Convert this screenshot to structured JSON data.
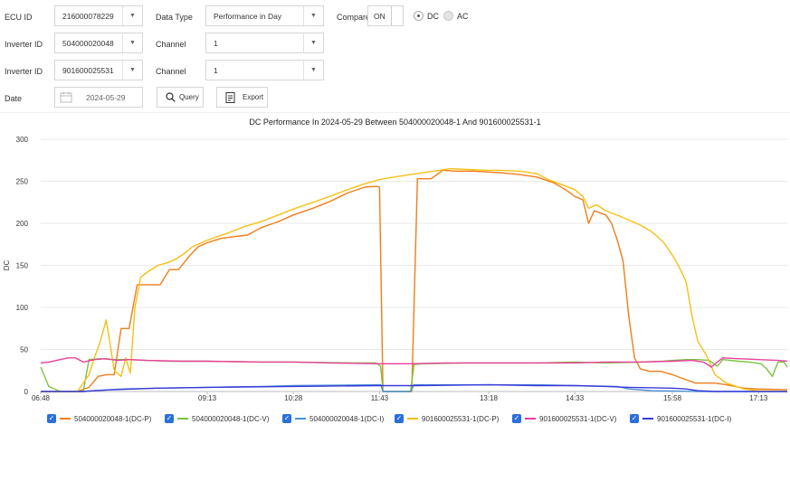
{
  "controls": {
    "ecu_label": "ECU ID",
    "ecu_value": "216000078229",
    "datatype_label": "Data Type",
    "datatype_value": "Performance in Day",
    "compare_label": "Compare",
    "compare_value": "ON",
    "radio_dc": "DC",
    "radio_ac": "AC",
    "inverter1_label": "Inverter ID",
    "inverter1_value": "504000020048",
    "channel1_label": "Channel",
    "channel1_value": "1",
    "inverter2_label": "Inverter ID",
    "inverter2_value": "901600025531",
    "channel2_label": "Channel",
    "channel2_value": "1",
    "date_label": "Date",
    "date_value": "2024-05-29",
    "query_label": "Query",
    "export_label": "Export"
  },
  "colors": {
    "s1_p": "#f07d1a",
    "s1_v": "#7cc242",
    "s1_i": "#4a90d9",
    "s2_p": "#f5c016",
    "s2_v": "#e8409b",
    "s2_i": "#3b3bd8",
    "checkbox": "#2a6fdb"
  },
  "chart_data": {
    "type": "line",
    "title": "DC Performance In 2024-05-29 Between 504000020048-1 And 901600025531-1",
    "ylabel": "DC",
    "xlabel": "",
    "ylim": [
      0,
      300
    ],
    "yticks": [
      0,
      50,
      100,
      150,
      200,
      250,
      300
    ],
    "xlim": [
      "06:48",
      "17:38"
    ],
    "xticks": [
      "06:48",
      "09:13",
      "10:28",
      "11:43",
      "13:18",
      "14:33",
      "15:58",
      "17:13"
    ],
    "grid": "horizontal",
    "legend_position": "bottom",
    "series": [
      {
        "name": "504000020048-1(DC-P)",
        "color_key": "s1_p",
        "points": [
          [
            "06:48",
            0
          ],
          [
            "07:20",
            0
          ],
          [
            "07:30",
            5
          ],
          [
            "07:38",
            18
          ],
          [
            "07:45",
            20
          ],
          [
            "07:52",
            20
          ],
          [
            "07:58",
            75
          ],
          [
            "08:05",
            75
          ],
          [
            "08:12",
            127
          ],
          [
            "08:20",
            127
          ],
          [
            "08:32",
            127
          ],
          [
            "08:40",
            145
          ],
          [
            "08:48",
            145
          ],
          [
            "08:58",
            162
          ],
          [
            "09:05",
            172
          ],
          [
            "09:13",
            177
          ],
          [
            "09:25",
            182
          ],
          [
            "09:35",
            184
          ],
          [
            "09:48",
            186
          ],
          [
            "10:00",
            195
          ],
          [
            "10:15",
            202
          ],
          [
            "10:28",
            210
          ],
          [
            "10:45",
            218
          ],
          [
            "11:00",
            226
          ],
          [
            "11:15",
            236
          ],
          [
            "11:30",
            243
          ],
          [
            "11:40",
            244
          ],
          [
            "11:43",
            243
          ],
          [
            "11:46",
            0
          ],
          [
            "12:11",
            0
          ],
          [
            "12:16",
            253
          ],
          [
            "12:28",
            253
          ],
          [
            "12:38",
            263
          ],
          [
            "12:50",
            262
          ],
          [
            "13:05",
            262
          ],
          [
            "13:18",
            261
          ],
          [
            "13:30",
            260
          ],
          [
            "13:45",
            258
          ],
          [
            "14:00",
            255
          ],
          [
            "14:15",
            248
          ],
          [
            "14:25",
            240
          ],
          [
            "14:33",
            232
          ],
          [
            "14:40",
            228
          ],
          [
            "14:45",
            200
          ],
          [
            "14:50",
            215
          ],
          [
            "15:00",
            210
          ],
          [
            "15:05",
            200
          ],
          [
            "15:10",
            180
          ],
          [
            "15:15",
            155
          ],
          [
            "15:20",
            90
          ],
          [
            "15:25",
            40
          ],
          [
            "15:30",
            27
          ],
          [
            "15:38",
            24
          ],
          [
            "15:48",
            24
          ],
          [
            "15:58",
            20
          ],
          [
            "16:08",
            15
          ],
          [
            "16:18",
            10
          ],
          [
            "16:35",
            10
          ],
          [
            "16:45",
            8
          ],
          [
            "17:00",
            4
          ],
          [
            "17:13",
            3
          ],
          [
            "17:38",
            2
          ]
        ]
      },
      {
        "name": "504000020048-1(DC-V)",
        "color_key": "s1_v",
        "points": [
          [
            "06:48",
            29
          ],
          [
            "06:55",
            6
          ],
          [
            "07:05",
            0
          ],
          [
            "07:25",
            0
          ],
          [
            "07:30",
            38
          ],
          [
            "07:40",
            39
          ],
          [
            "07:50",
            38
          ],
          [
            "08:05",
            38
          ],
          [
            "08:20",
            37
          ],
          [
            "08:40",
            36
          ],
          [
            "09:13",
            36
          ],
          [
            "10:00",
            35
          ],
          [
            "10:28",
            35
          ],
          [
            "11:20",
            34
          ],
          [
            "11:40",
            34
          ],
          [
            "11:44",
            30
          ],
          [
            "11:46",
            0
          ],
          [
            "12:10",
            0
          ],
          [
            "12:13",
            32
          ],
          [
            "12:20",
            33
          ],
          [
            "13:00",
            34
          ],
          [
            "13:18",
            34
          ],
          [
            "14:00",
            34
          ],
          [
            "14:33",
            35
          ],
          [
            "15:00",
            34
          ],
          [
            "15:30",
            35
          ],
          [
            "15:50",
            36
          ],
          [
            "15:58",
            37
          ],
          [
            "16:10",
            38
          ],
          [
            "16:20",
            38
          ],
          [
            "16:30",
            37
          ],
          [
            "16:37",
            30
          ],
          [
            "16:42",
            38
          ],
          [
            "16:55",
            36
          ],
          [
            "17:05",
            35
          ],
          [
            "17:15",
            33
          ],
          [
            "17:20",
            27
          ],
          [
            "17:25",
            18
          ],
          [
            "17:30",
            35
          ],
          [
            "17:35",
            35
          ],
          [
            "17:38",
            29
          ]
        ]
      },
      {
        "name": "504000020048-1(DC-I)",
        "color_key": "s1_i",
        "points": [
          [
            "06:48",
            0
          ],
          [
            "07:25",
            0
          ],
          [
            "07:35",
            1
          ],
          [
            "08:00",
            3
          ],
          [
            "08:30",
            4
          ],
          [
            "09:13",
            5
          ],
          [
            "10:00",
            6
          ],
          [
            "10:28",
            7
          ],
          [
            "11:40",
            8
          ],
          [
            "11:44",
            8
          ],
          [
            "11:46",
            0
          ],
          [
            "12:10",
            0
          ],
          [
            "12:13",
            8
          ],
          [
            "13:18",
            8
          ],
          [
            "14:00",
            8
          ],
          [
            "14:33",
            7
          ],
          [
            "15:10",
            6
          ],
          [
            "15:20",
            3
          ],
          [
            "15:40",
            1
          ],
          [
            "16:20",
            0
          ],
          [
            "17:38",
            0
          ]
        ]
      },
      {
        "name": "901600025531-1(DC-P)",
        "color_key": "s2_p",
        "points": [
          [
            "06:48",
            0
          ],
          [
            "07:20",
            0
          ],
          [
            "07:30",
            20
          ],
          [
            "07:36",
            45
          ],
          [
            "07:40",
            60
          ],
          [
            "07:45",
            85
          ],
          [
            "07:48",
            60
          ],
          [
            "07:52",
            25
          ],
          [
            "07:58",
            18
          ],
          [
            "08:02",
            40
          ],
          [
            "08:06",
            22
          ],
          [
            "08:10",
            100
          ],
          [
            "08:15",
            136
          ],
          [
            "08:22",
            143
          ],
          [
            "08:30",
            150
          ],
          [
            "08:38",
            153
          ],
          [
            "08:45",
            157
          ],
          [
            "08:52",
            163
          ],
          [
            "09:00",
            172
          ],
          [
            "09:13",
            180
          ],
          [
            "09:30",
            188
          ],
          [
            "09:45",
            196
          ],
          [
            "10:00",
            202
          ],
          [
            "10:15",
            210
          ],
          [
            "10:28",
            217
          ],
          [
            "10:45",
            225
          ],
          [
            "11:00",
            232
          ],
          [
            "11:15",
            240
          ],
          [
            "11:30",
            247
          ],
          [
            "11:43",
            252
          ],
          [
            "12:00",
            256
          ],
          [
            "12:15",
            259
          ],
          [
            "12:30",
            262
          ],
          [
            "12:45",
            265
          ],
          [
            "13:00",
            264
          ],
          [
            "13:18",
            263
          ],
          [
            "13:30",
            263
          ],
          [
            "13:45",
            262
          ],
          [
            "14:00",
            259
          ],
          [
            "14:10",
            252
          ],
          [
            "14:20",
            247
          ],
          [
            "14:33",
            240
          ],
          [
            "14:40",
            232
          ],
          [
            "14:45",
            218
          ],
          [
            "14:52",
            222
          ],
          [
            "15:00",
            215
          ],
          [
            "15:15",
            207
          ],
          [
            "15:30",
            198
          ],
          [
            "15:40",
            190
          ],
          [
            "15:50",
            178
          ],
          [
            "15:58",
            162
          ],
          [
            "16:05",
            145
          ],
          [
            "16:10",
            130
          ],
          [
            "16:15",
            90
          ],
          [
            "16:20",
            60
          ],
          [
            "16:28",
            42
          ],
          [
            "16:35",
            20
          ],
          [
            "16:45",
            10
          ],
          [
            "17:00",
            3
          ],
          [
            "17:13",
            1
          ],
          [
            "17:38",
            0
          ]
        ]
      },
      {
        "name": "901600025531-1(DC-V)",
        "color_key": "s2_v",
        "points": [
          [
            "06:48",
            34
          ],
          [
            "06:55",
            35
          ],
          [
            "07:05",
            38
          ],
          [
            "07:12",
            40
          ],
          [
            "07:18",
            40
          ],
          [
            "07:25",
            35
          ],
          [
            "07:35",
            38
          ],
          [
            "07:45",
            39
          ],
          [
            "07:55",
            37
          ],
          [
            "08:05",
            38
          ],
          [
            "08:20",
            37
          ],
          [
            "08:50",
            36
          ],
          [
            "09:13",
            36
          ],
          [
            "10:00",
            35
          ],
          [
            "10:28",
            35
          ],
          [
            "11:00",
            34
          ],
          [
            "11:43",
            33
          ],
          [
            "12:10",
            33
          ],
          [
            "12:40",
            34
          ],
          [
            "13:18",
            34
          ],
          [
            "14:00",
            34
          ],
          [
            "14:33",
            34
          ],
          [
            "15:00",
            35
          ],
          [
            "15:30",
            35
          ],
          [
            "15:58",
            36
          ],
          [
            "16:15",
            37
          ],
          [
            "16:25",
            35
          ],
          [
            "16:32",
            29
          ],
          [
            "16:37",
            35
          ],
          [
            "16:42",
            40
          ],
          [
            "16:55",
            39
          ],
          [
            "17:13",
            38
          ],
          [
            "17:30",
            37
          ],
          [
            "17:38",
            36
          ]
        ]
      },
      {
        "name": "901600025531-1(DC-I)",
        "color_key": "s2_i",
        "points": [
          [
            "06:48",
            0
          ],
          [
            "07:25",
            0
          ],
          [
            "07:35",
            1
          ],
          [
            "07:50",
            2
          ],
          [
            "08:10",
            3
          ],
          [
            "08:30",
            4
          ],
          [
            "09:13",
            5
          ],
          [
            "10:28",
            6
          ],
          [
            "11:43",
            7
          ],
          [
            "12:15",
            7
          ],
          [
            "13:18",
            8
          ],
          [
            "14:00",
            7
          ],
          [
            "14:33",
            7
          ],
          [
            "15:00",
            6
          ],
          [
            "15:20",
            5
          ],
          [
            "15:58",
            4
          ],
          [
            "16:10",
            3
          ],
          [
            "16:20",
            1
          ],
          [
            "16:35",
            0
          ],
          [
            "17:38",
            0
          ]
        ]
      }
    ]
  }
}
